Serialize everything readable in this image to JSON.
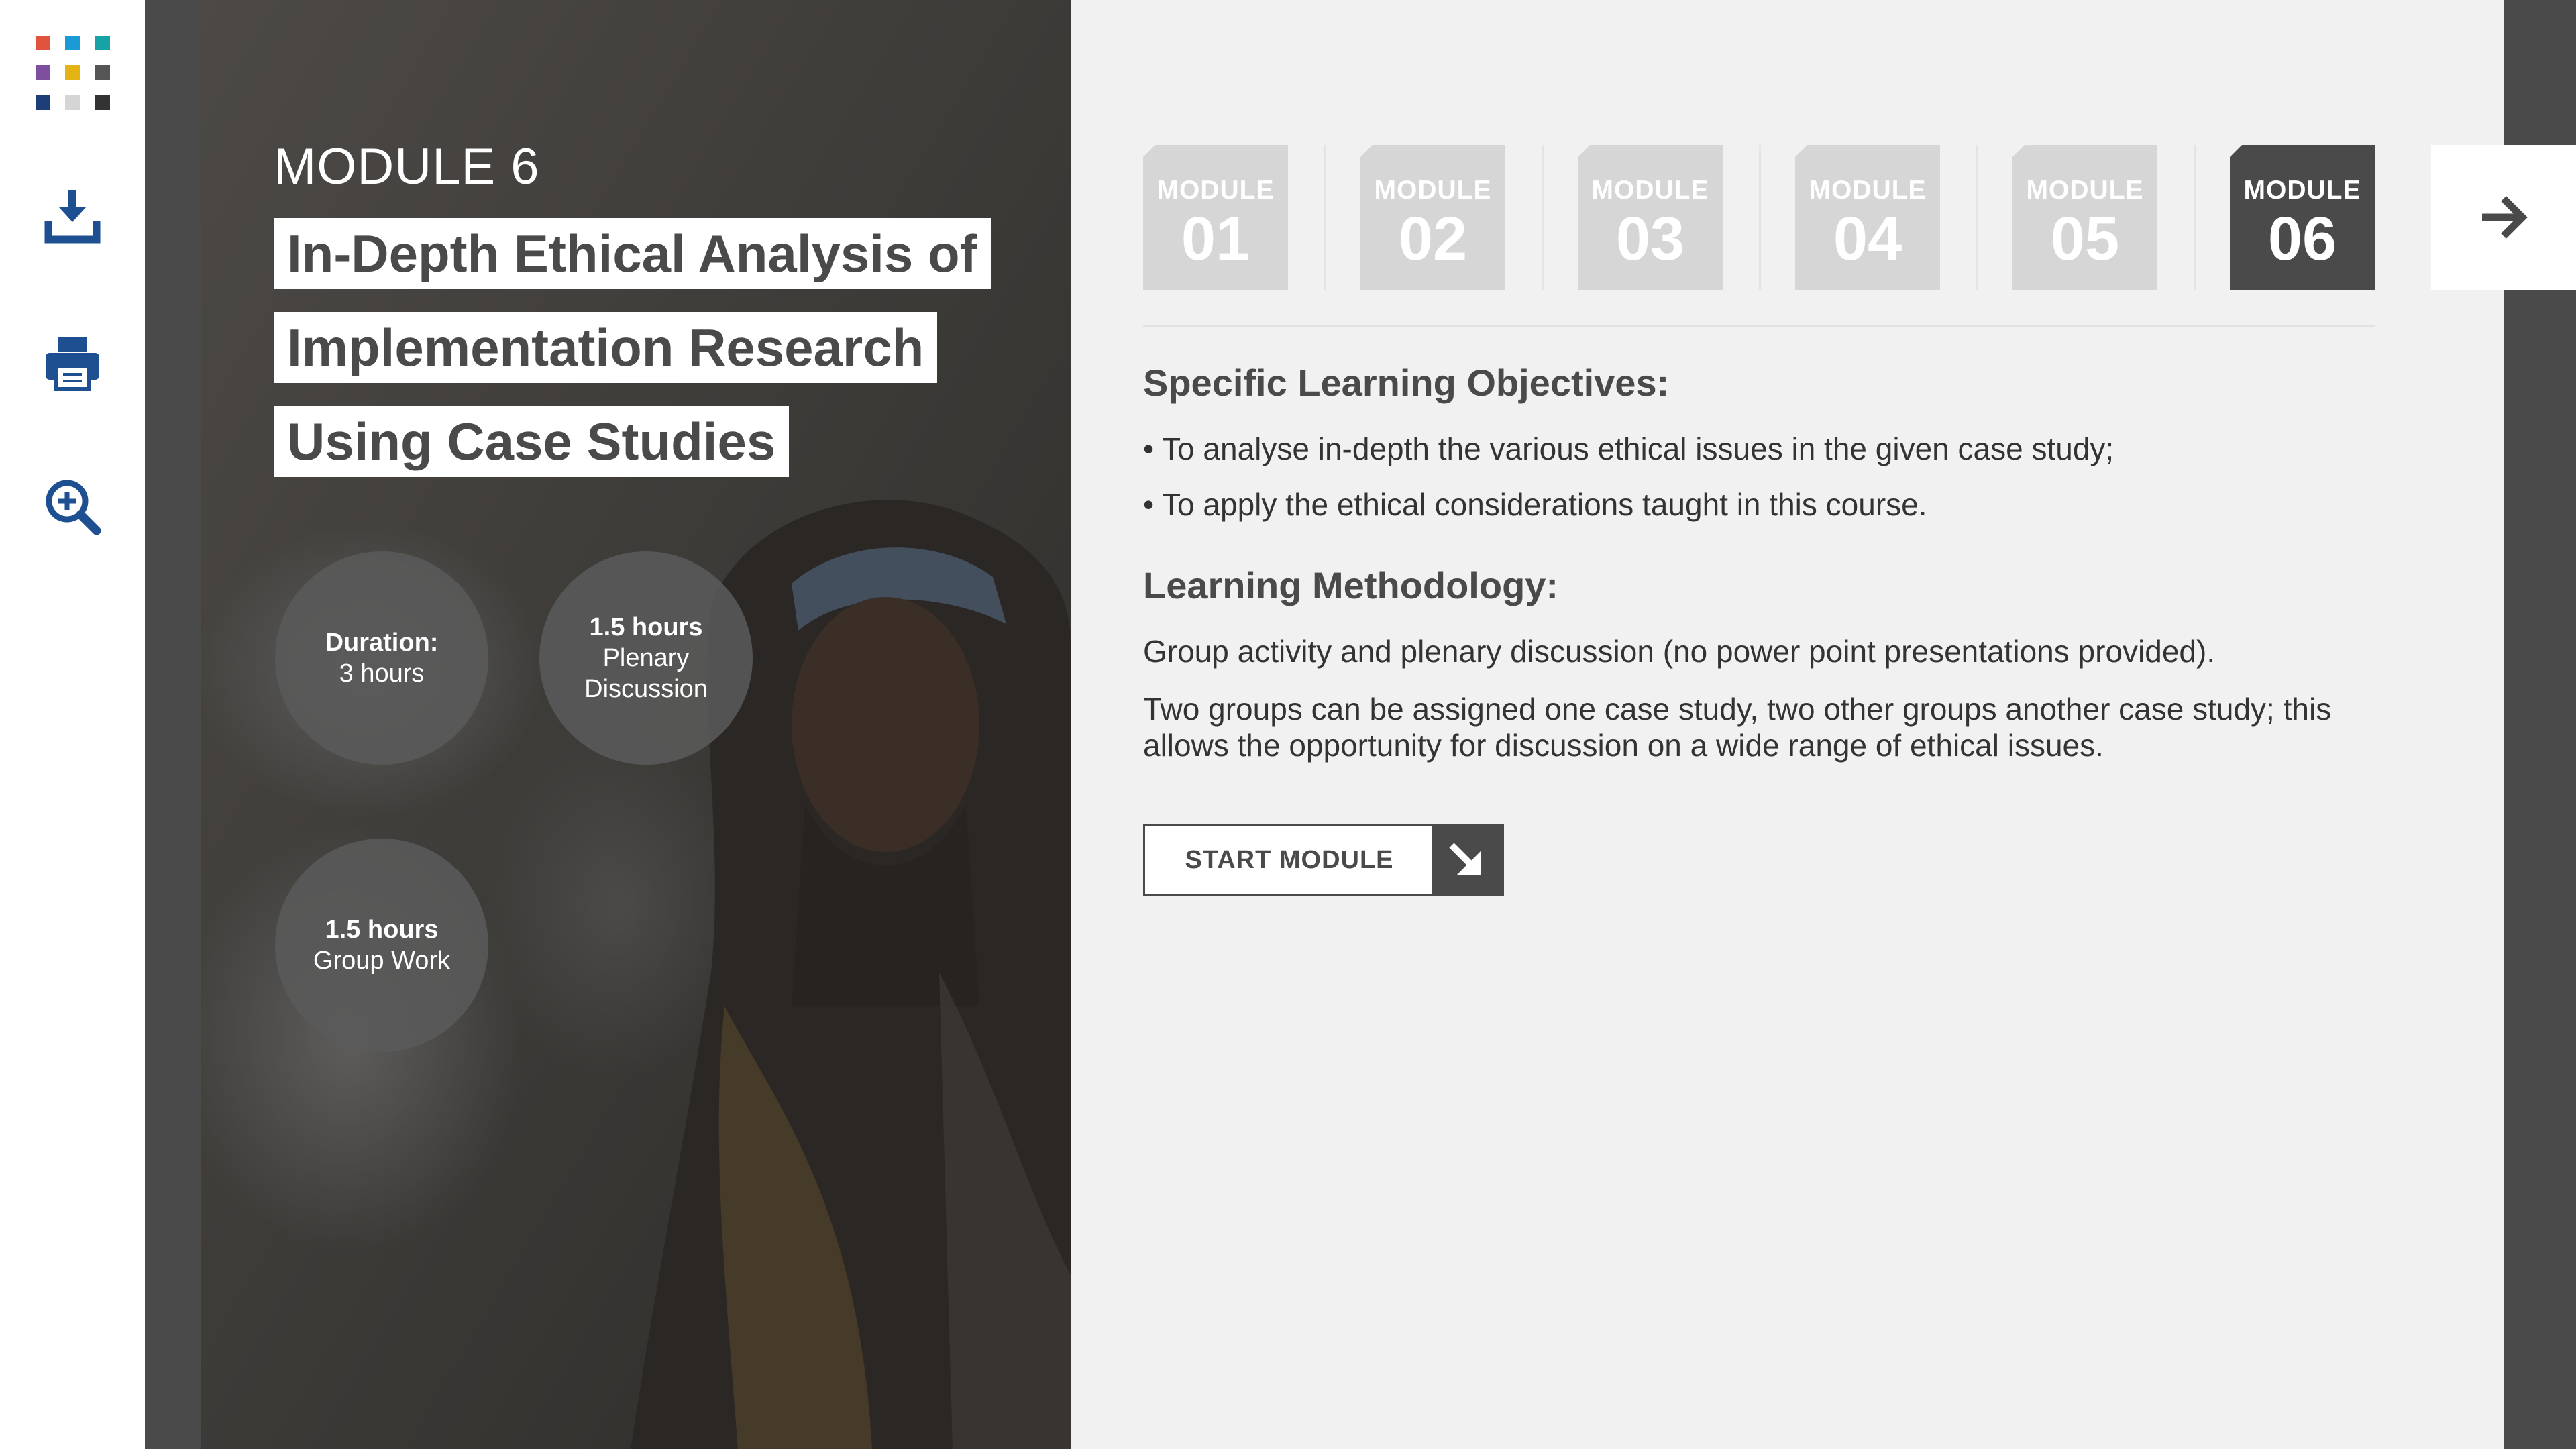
{
  "toolbar": {
    "logo_colors": [
      "#e0533d",
      "#1b9ad6",
      "#17a3a5",
      "#7d4f9e",
      "#e4b314",
      "#555555",
      "#1e3e79",
      "#d5d5d5",
      "#333333"
    ],
    "tools": [
      {
        "name": "download-icon",
        "color": "#1e4f91"
      },
      {
        "name": "print-icon",
        "color": "#1e4f91"
      },
      {
        "name": "zoom-in-icon",
        "color": "#1e4f91"
      }
    ]
  },
  "hero": {
    "module_label": "MODULE 6",
    "title_lines": [
      "In-Depth Ethical Analysis of",
      "Implementation Research",
      "Using Case Studies"
    ],
    "stats": [
      {
        "strong": "Duration:",
        "text": "3 hours"
      },
      {
        "strong": "1.5 hours",
        "text_lines": [
          "Plenary",
          "Discussion"
        ]
      },
      {
        "strong": "1.5 hours",
        "text": "Group Work"
      }
    ]
  },
  "tabs": [
    {
      "label": "MODULE",
      "num": "01",
      "active": false
    },
    {
      "label": "MODULE",
      "num": "02",
      "active": false
    },
    {
      "label": "MODULE",
      "num": "03",
      "active": false
    },
    {
      "label": "MODULE",
      "num": "04",
      "active": false
    },
    {
      "label": "MODULE",
      "num": "05",
      "active": false
    },
    {
      "label": "MODULE",
      "num": "06",
      "active": true
    }
  ],
  "content": {
    "objectives_heading": "Specific Learning Objectives:",
    "objectives": [
      "• To analyse in-depth the various ethical issues in the given case study;",
      "• To apply the ethical considerations taught in this course."
    ],
    "methodology_heading": "Learning Methodology:",
    "methodology_paragraphs": [
      "Group activity and plenary discussion (no power point presentations provided).",
      "Two groups can be assigned one case study, two other groups another case study; this allows the opportunity for discussion on a wide range of ethical issues."
    ],
    "start_button": "START MODULE"
  },
  "colors": {
    "dark": "#4a4a4a",
    "tab_inactive": "#d6d6d6",
    "background": "#f1f1f1",
    "toolbar_icon": "#1e4f91"
  }
}
